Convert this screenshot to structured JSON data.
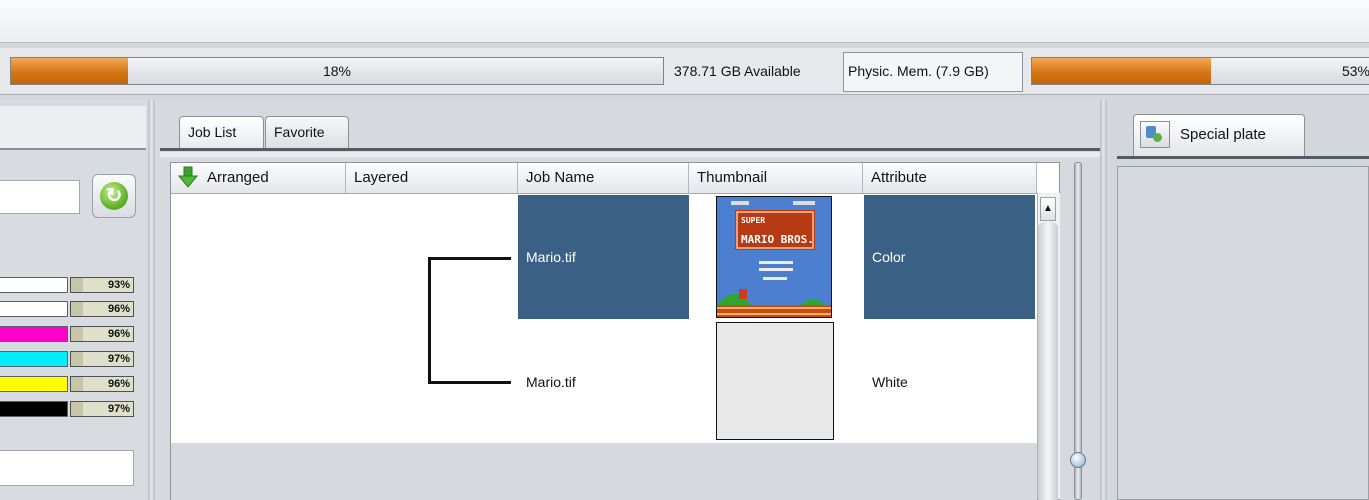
{
  "status": {
    "disk_usage_percent_label": "18%",
    "disk_usage_percent": 18,
    "disk_available": "378.71 GB Available",
    "physical_memory_label": "Physic. Mem. (7.9 GB)",
    "memory_usage_percent_label": "53%",
    "memory_usage_percent": 53
  },
  "ink_levels": [
    {
      "label": "93%",
      "color": "#ffffff"
    },
    {
      "label": "96%",
      "color": "#ffffff"
    },
    {
      "label": "96%",
      "color": "#ff00cc"
    },
    {
      "label": "97%",
      "color": "#00eeff"
    },
    {
      "label": "96%",
      "color": "#ffff00"
    },
    {
      "label": "97%",
      "color": "#000000"
    }
  ],
  "tabs": {
    "job_list": "Job List",
    "favorite": "Favorite"
  },
  "table": {
    "columns": [
      "Arranged",
      "Layered",
      "Job Name",
      "Thumbnail",
      "Attribute"
    ],
    "rows": [
      {
        "job_name": "Mario.tif",
        "attribute": "Color",
        "selected": true
      },
      {
        "job_name": "Mario.tif",
        "attribute": "White",
        "selected": false
      }
    ]
  },
  "thumbnail_1": {
    "title_top": "SUPER",
    "title_main": "MARIO BROS."
  },
  "right_panel": {
    "special_plate_tab": "Special plate"
  },
  "colors": {
    "progress_fill": "#d67714",
    "selection": "#3a6185"
  }
}
